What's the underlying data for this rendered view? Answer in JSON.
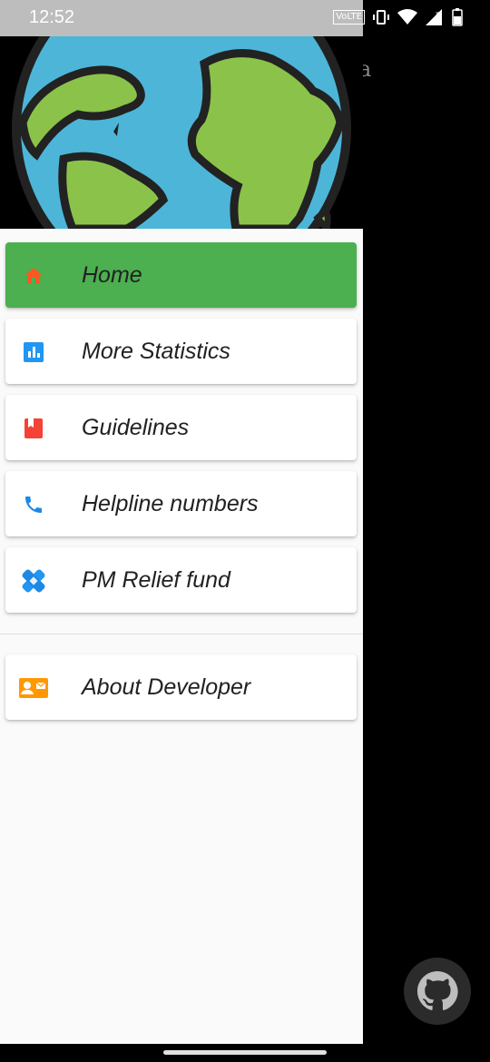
{
  "status_bar": {
    "time": "12:52",
    "network_badge": "VoLTE"
  },
  "background": {
    "title_fragment": "a"
  },
  "drawer": {
    "items": [
      {
        "label": "Home",
        "icon": "home-icon",
        "icon_color": "#ff5722",
        "active": true
      },
      {
        "label": "More Statistics",
        "icon": "bar-chart-icon",
        "icon_color": "#2196f3"
      },
      {
        "label": "Guidelines",
        "icon": "book-icon",
        "icon_color": "#f44336"
      },
      {
        "label": "Helpline numbers",
        "icon": "phone-icon",
        "icon_color": "#1e88e5"
      },
      {
        "label": "PM Relief fund",
        "icon": "bandage-icon",
        "icon_color": "#2196f3"
      },
      {
        "label": "About Developer",
        "icon": "contact-card-icon",
        "icon_color": "#ff9800"
      }
    ],
    "active_color": "#4caf50"
  },
  "fab": {
    "icon": "github-icon"
  }
}
